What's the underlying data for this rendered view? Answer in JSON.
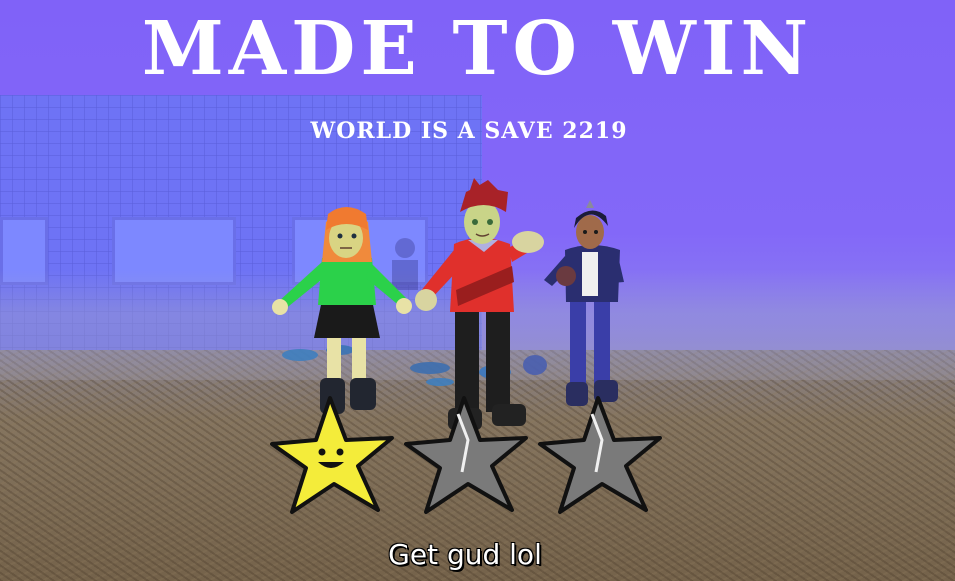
{
  "title": "MADE TO WIN",
  "subtitle": "WORLD IS A SAVE 2219",
  "rating": {
    "earned": 1,
    "total": 3
  },
  "caption": "Get gud lol",
  "colors": {
    "sky": "#8066f7",
    "building": "#6e73f5",
    "star_earned": "#f4ec3a",
    "star_empty": "#7a7a7a"
  }
}
